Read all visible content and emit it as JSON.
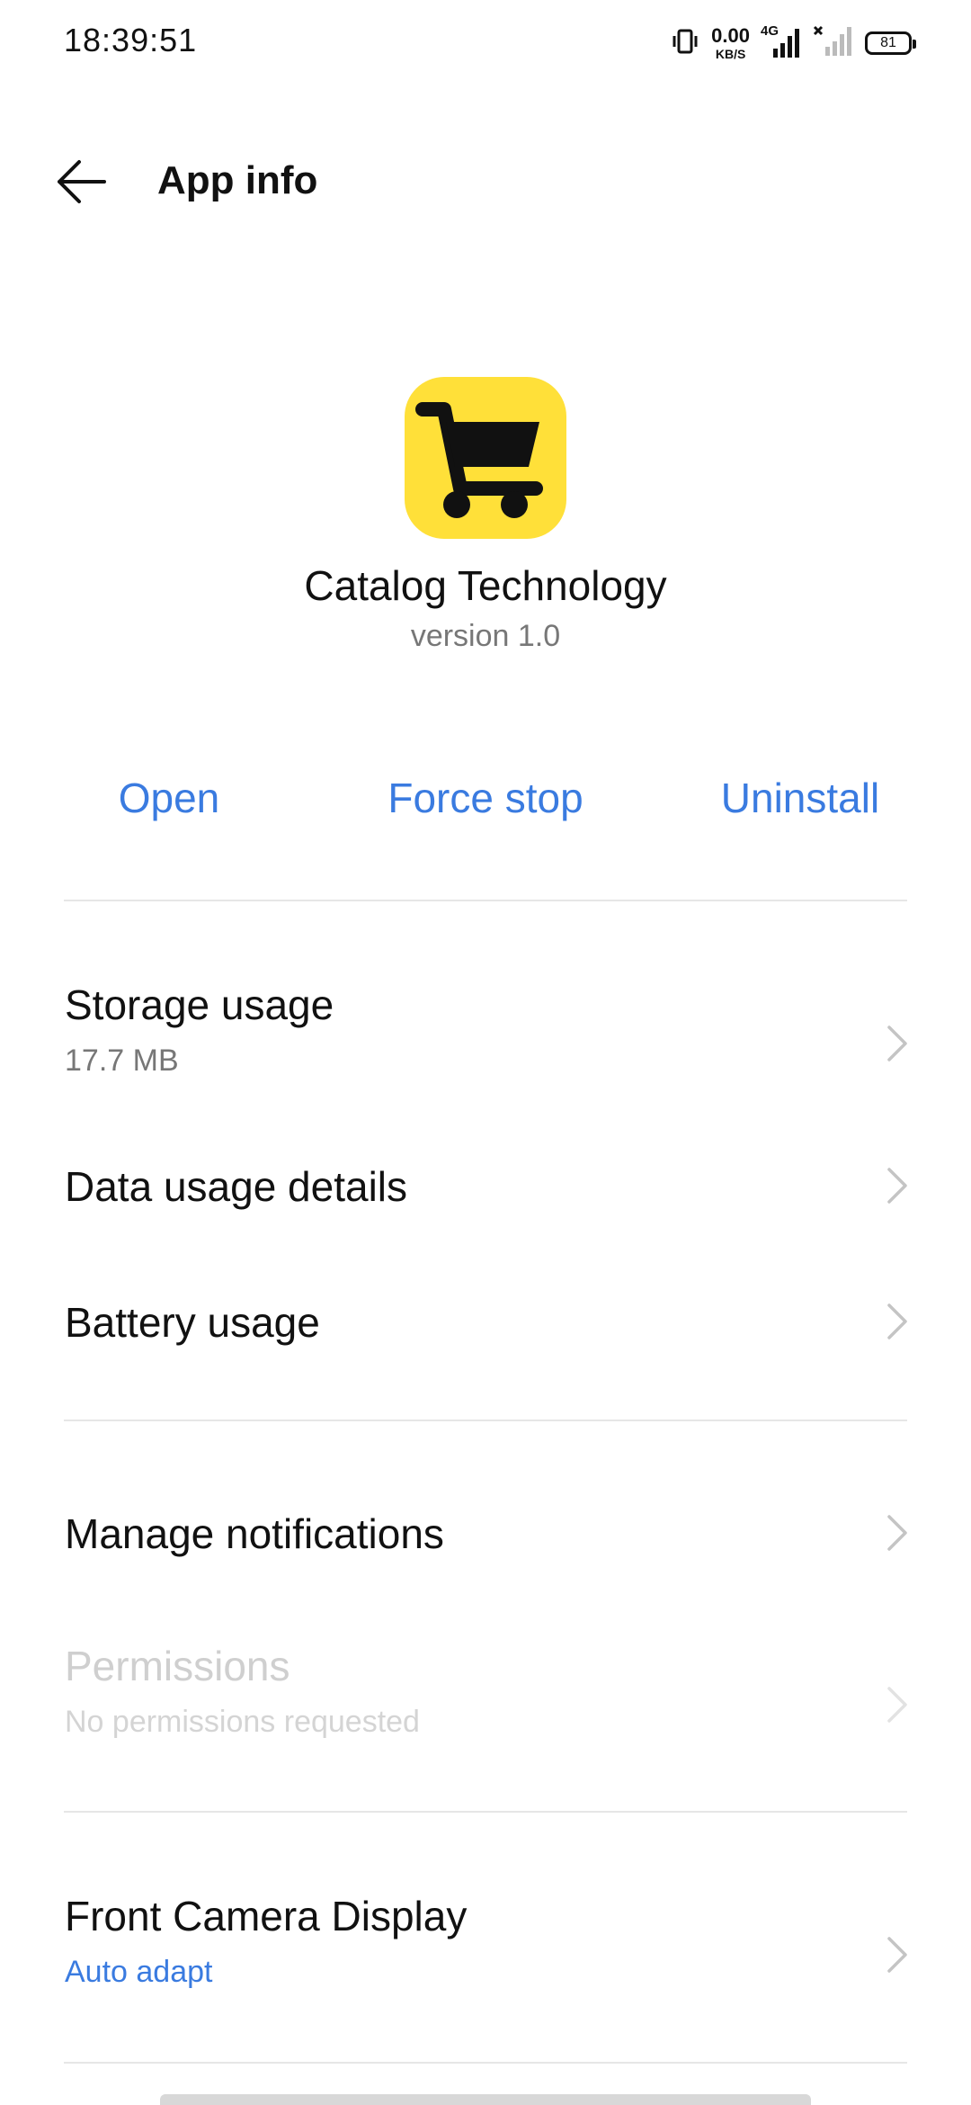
{
  "status_bar": {
    "time": "18:39:51",
    "net_speed_value": "0.00",
    "net_speed_unit": "KB/S",
    "network_type": "4G",
    "battery_level": "81"
  },
  "toolbar": {
    "back_icon": "arrow-left-icon",
    "title": "App info"
  },
  "app": {
    "icon": "shopping-cart-icon",
    "icon_bg": "#FFE039",
    "name": "Catalog Technology",
    "version": "version 1.0"
  },
  "actions": {
    "open": "Open",
    "force_stop": "Force stop",
    "uninstall": "Uninstall",
    "accent_color": "#3A7BE0"
  },
  "settings": {
    "storage": {
      "title": "Storage usage",
      "subtitle": "17.7 MB"
    },
    "data_usage": {
      "title": "Data usage details"
    },
    "battery": {
      "title": "Battery usage"
    },
    "notifications": {
      "title": "Manage notifications"
    },
    "permissions": {
      "title": "Permissions",
      "subtitle": "No permissions requested",
      "enabled": false
    },
    "front_camera": {
      "title": "Front Camera Display",
      "subtitle": "Auto adapt"
    }
  }
}
